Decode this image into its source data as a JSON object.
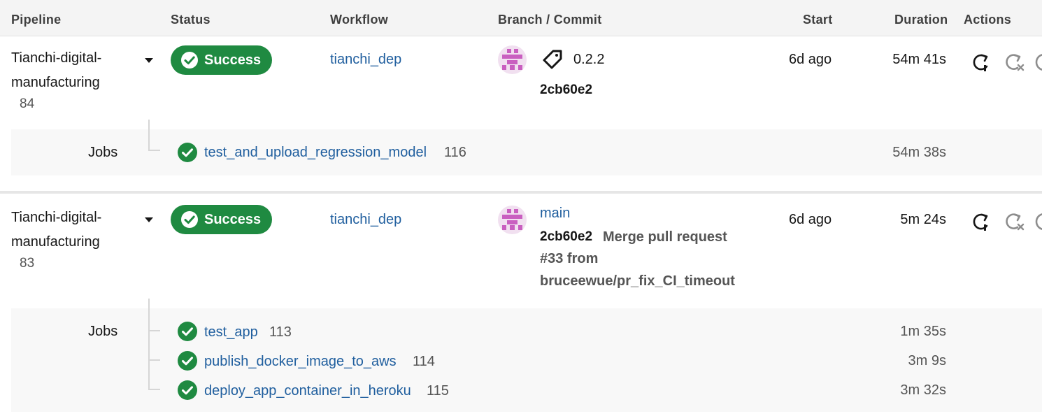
{
  "header": {
    "pipeline": "Pipeline",
    "status": "Status",
    "workflow": "Workflow",
    "branch_commit": "Branch / Commit",
    "start": "Start",
    "duration": "Duration",
    "actions": "Actions"
  },
  "pipelines": [
    {
      "name_line1": "Tianchi-digital-",
      "name_line2": "manufacturing",
      "number": "84",
      "status": "Success",
      "workflow": "tianchi_dep",
      "tag": "0.2.2",
      "sha": "2cb60e2",
      "start": "6d ago",
      "duration": "54m 41s",
      "jobs_label": "Jobs",
      "jobs": [
        {
          "name": "test_and_upload_regression_model",
          "number": "116",
          "duration": "54m 38s"
        }
      ]
    },
    {
      "name_line1": "Tianchi-digital-",
      "name_line2": "manufacturing",
      "number": "83",
      "status": "Success",
      "workflow": "tianchi_dep",
      "branch": "main",
      "sha": "2cb60e2",
      "message_line1": "Merge pull request",
      "message_line2": "#33 from",
      "message_line3": "bruceewue/pr_fix_CI_timeout",
      "start": "6d ago",
      "duration": "5m 24s",
      "jobs_label": "Jobs",
      "jobs": [
        {
          "name": "test_app",
          "number": "113",
          "duration": "1m 35s"
        },
        {
          "name": "publish_docker_image_to_aws",
          "number": "114",
          "duration": "3m 9s"
        },
        {
          "name": "deploy_app_container_in_heroku",
          "number": "115",
          "duration": "3m 32s"
        }
      ]
    }
  ],
  "icons": {
    "status": "check-circle-icon",
    "expand": "caret-down-icon",
    "tag": "tag-icon",
    "rerun": "rerun-icon",
    "rerun_failed": "rerun-failed-icon",
    "cancel": "cancel-icon"
  },
  "colors": {
    "success": "#1f8a41",
    "link": "#1f5e9e",
    "avatar": "#c95fc0"
  }
}
